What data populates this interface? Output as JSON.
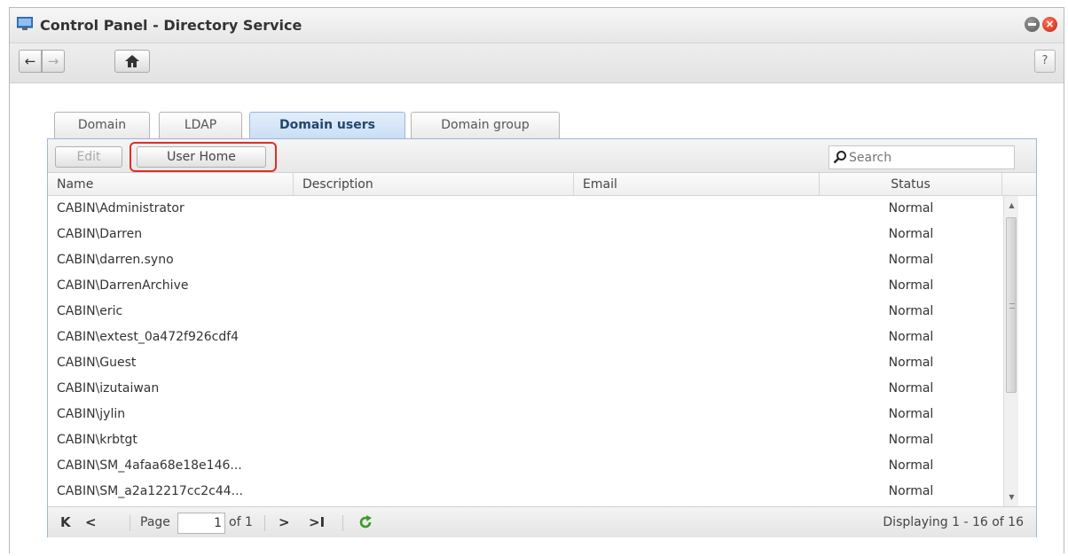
{
  "window": {
    "title": "Control Panel - Directory Service",
    "help_label": "?"
  },
  "toolbar": {
    "back_glyph": "←",
    "forward_glyph": "→",
    "home_glyph": "⌂"
  },
  "tabs": [
    {
      "label": "Domain",
      "active": false
    },
    {
      "label": "LDAP",
      "active": false
    },
    {
      "label": "Domain users",
      "active": true
    },
    {
      "label": "Domain group",
      "active": false
    }
  ],
  "grid_toolbar": {
    "edit_label": "Edit",
    "user_home_label": "User Home",
    "search_placeholder": "Search"
  },
  "columns": [
    "Name",
    "Description",
    "Email",
    "Status"
  ],
  "rows": [
    {
      "name": "CABIN\\Administrator",
      "description": "",
      "email": "",
      "status": "Normal"
    },
    {
      "name": "CABIN\\Darren",
      "description": "",
      "email": "",
      "status": "Normal"
    },
    {
      "name": "CABIN\\darren.syno",
      "description": "",
      "email": "",
      "status": "Normal"
    },
    {
      "name": "CABIN\\DarrenArchive",
      "description": "",
      "email": "",
      "status": "Normal"
    },
    {
      "name": "CABIN\\eric",
      "description": "",
      "email": "",
      "status": "Normal"
    },
    {
      "name": "CABIN\\extest_0a472f926cdf4",
      "description": "",
      "email": "",
      "status": "Normal"
    },
    {
      "name": "CABIN\\Guest",
      "description": "",
      "email": "",
      "status": "Normal"
    },
    {
      "name": "CABIN\\izutaiwan",
      "description": "",
      "email": "",
      "status": "Normal"
    },
    {
      "name": "CABIN\\jylin",
      "description": "",
      "email": "",
      "status": "Normal"
    },
    {
      "name": "CABIN\\krbtgt",
      "description": "",
      "email": "",
      "status": "Normal"
    },
    {
      "name": "CABIN\\SM_4afaa68e18e146...",
      "description": "",
      "email": "",
      "status": "Normal"
    },
    {
      "name": "CABIN\\SM_a2a12217cc2c44...",
      "description": "",
      "email": "",
      "status": "Normal"
    }
  ],
  "pager": {
    "first_glyph": "K",
    "prev_glyph": "<",
    "page_label": "Page",
    "page_value": "1",
    "of_label": "of 1",
    "next_glyph": ">",
    "last_glyph": ">I",
    "displaying": "Displaying 1 - 16 of 16"
  },
  "colors": {
    "accent_tab": "#c9ddf4",
    "highlight_border": "#d9302a",
    "refresh_green": "#3a9a2a"
  }
}
